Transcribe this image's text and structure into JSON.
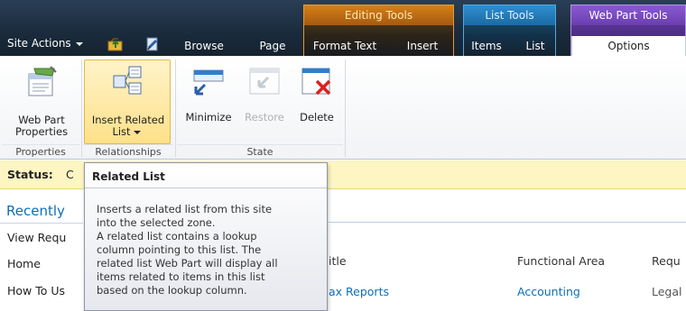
{
  "topbar": {
    "site_actions": "Site Actions",
    "tabs": [
      "Browse",
      "Page"
    ],
    "context_groups": [
      {
        "title": "Editing Tools",
        "tabs": [
          "Format Text",
          "Insert"
        ]
      },
      {
        "title": "List Tools",
        "tabs": [
          "Items",
          "List"
        ]
      },
      {
        "title": "Web Part Tools",
        "tabs": [
          "Options"
        ]
      }
    ]
  },
  "ribbon": {
    "buttons": {
      "web_part_properties": "Web Part Properties",
      "insert_related_list_1": "Insert Related",
      "insert_related_list_2": "List",
      "minimize": "Minimize",
      "restore": "Restore",
      "delete": "Delete"
    },
    "groups": {
      "properties": "Properties",
      "relationships": "Relationships",
      "state": "State"
    }
  },
  "status": {
    "label": "Status:",
    "value": "C"
  },
  "nav": {
    "recently": "Recently",
    "items": [
      "View Requ",
      "Home",
      "How To Us"
    ]
  },
  "list": {
    "columns": [
      "itle",
      "Functional Area",
      "Requ"
    ],
    "rows": [
      {
        "title": "ax Reports",
        "area": "Accounting",
        "req": "Legal"
      }
    ]
  },
  "tooltip": {
    "title": "Related List",
    "lines": [
      "Inserts a related list from this site",
      "into the selected zone.",
      "A related list contains a lookup",
      "column pointing to this list. The",
      "related list Web Part will display all",
      "items related to items in this list",
      "based on the lookup column."
    ]
  },
  "colors": {
    "editing": "#e59a2c",
    "list": "#2f8ed0",
    "webpart": "#8a5ad0",
    "link": "#0b6fb8",
    "status_bg": "#fdf5c2"
  }
}
